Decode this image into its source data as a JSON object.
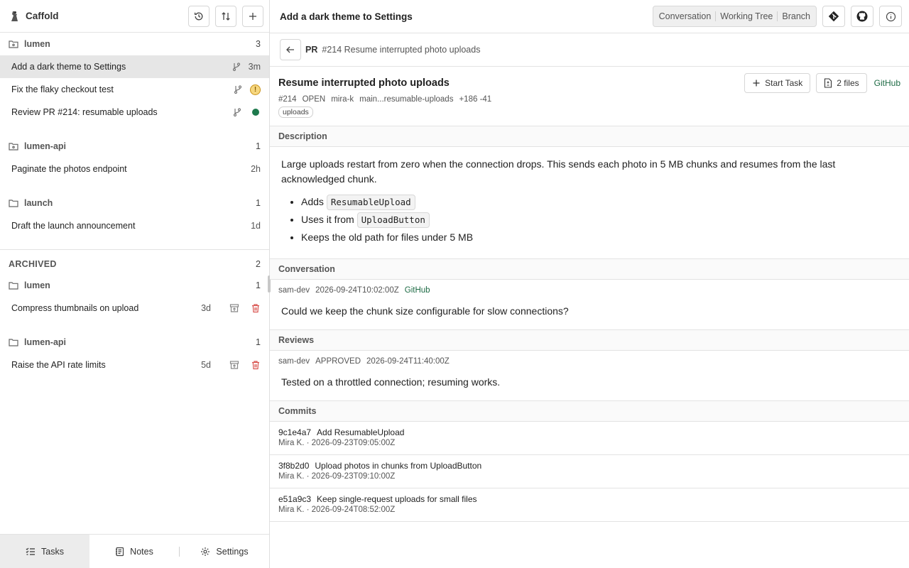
{
  "app": {
    "name": "Caffold"
  },
  "sidebar": {
    "groups": [
      {
        "name": "lumen",
        "count": "3",
        "tasks": [
          {
            "name": "Add a dark theme to Settings",
            "age": "3m",
            "selected": true,
            "status": "branch"
          },
          {
            "name": "Fix the flaky checkout test",
            "status": "warning"
          },
          {
            "name": "Review PR #214: resumable uploads",
            "status": "ok"
          }
        ]
      },
      {
        "name": "lumen-api",
        "count": "1",
        "tasks": [
          {
            "name": "Paginate the photos endpoint",
            "age": "2h"
          }
        ]
      },
      {
        "name": "launch",
        "count": "1",
        "tasks": [
          {
            "name": "Draft the launch announcement",
            "age": "1d"
          }
        ]
      }
    ],
    "archived": {
      "label": "ARCHIVED",
      "count": "2",
      "groups": [
        {
          "name": "lumen",
          "count": "1",
          "tasks": [
            {
              "name": "Compress thumbnails on upload",
              "age": "3d"
            }
          ]
        },
        {
          "name": "lumen-api",
          "count": "1",
          "tasks": [
            {
              "name": "Raise the API rate limits",
              "age": "5d"
            }
          ]
        }
      ]
    },
    "footer": {
      "tasks": "Tasks",
      "notes": "Notes",
      "settings": "Settings"
    }
  },
  "header": {
    "title": "Add a dark theme to Settings",
    "views": [
      "Conversation",
      "Working Tree",
      "Branch"
    ]
  },
  "breadcrumb": {
    "kind": "PR",
    "text": "#214 Resume interrupted photo uploads"
  },
  "pr": {
    "title": "Resume interrupted photo uploads",
    "number": "#214",
    "state": "OPEN",
    "author": "mira-k",
    "branch": "main...resumable-uploads",
    "diff": "+186 -41",
    "label": "uploads",
    "start_task": "Start Task",
    "files": "2 files",
    "github": "GitHub"
  },
  "description": {
    "heading": "Description",
    "text": "Large uploads restart from zero when the connection drops. This sends each photo in 5 MB chunks and resumes from the last acknowledged chunk.",
    "bullets": [
      {
        "text": "Adds ",
        "code": "ResumableUpload"
      },
      {
        "text": "Uses it from ",
        "code": "UploadButton"
      },
      {
        "text": "Keeps the old path for files under 5 MB",
        "code": ""
      }
    ]
  },
  "conversation": {
    "heading": "Conversation",
    "author": "sam-dev",
    "time": "2026-09-24T10:02:00Z",
    "source": "GitHub",
    "body": "Could we keep the chunk size configurable for slow connections?"
  },
  "reviews": {
    "heading": "Reviews",
    "author": "sam-dev",
    "state": "APPROVED",
    "time": "2026-09-24T11:40:00Z",
    "body": "Tested on a throttled connection; resuming works."
  },
  "commits": {
    "heading": "Commits",
    "items": [
      {
        "sha": "9c1e4a7",
        "message": "Add ResumableUpload",
        "meta": "Mira K. · 2026-09-23T09:05:00Z"
      },
      {
        "sha": "3f8b2d0",
        "message": "Upload photos in chunks from UploadButton",
        "meta": "Mira K. · 2026-09-23T09:10:00Z"
      },
      {
        "sha": "e51a9c3",
        "message": "Keep single-request uploads for small files",
        "meta": "Mira K. · 2026-09-24T08:52:00Z"
      }
    ]
  },
  "colors": {
    "accent_green": "#1e7a4d",
    "warning": "#f6d77f",
    "danger": "#d9534f"
  }
}
